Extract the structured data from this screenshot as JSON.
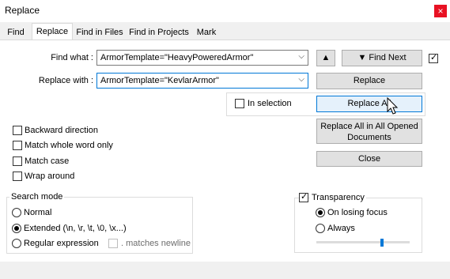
{
  "window": {
    "title": "Replace",
    "close_label": "×"
  },
  "tabs": [
    {
      "label": "Find"
    },
    {
      "label": "Replace"
    },
    {
      "label": "Find in Files"
    },
    {
      "label": "Find in Projects"
    },
    {
      "label": "Mark"
    }
  ],
  "find": {
    "label": "Find what :",
    "value": "ArmorTemplate=\"HeavyPoweredArmor\""
  },
  "replace": {
    "label": "Replace with :",
    "value": "ArmorTemplate=\"KevlarArmor\""
  },
  "buttons": {
    "up": "▲",
    "find_next": "▼ Find Next",
    "replace": "Replace",
    "replace_all": "Replace All",
    "replace_all_opened": "Replace All in All Opened Documents",
    "close": "Close"
  },
  "in_selection": {
    "label": "In selection",
    "checked": false
  },
  "options": [
    {
      "label": "Backward direction",
      "checked": false
    },
    {
      "label": "Match whole word only",
      "checked": false
    },
    {
      "label": "Match case",
      "checked": false
    },
    {
      "label": "Wrap around",
      "checked": false
    }
  ],
  "search_mode": {
    "title": "Search mode",
    "normal": "Normal",
    "extended": "Extended (\\n, \\r, \\t, \\0, \\x...)",
    "regex": "Regular expression",
    "matches_newline": ". matches newline",
    "selected": "extended"
  },
  "transparency": {
    "title": "Transparency",
    "checked": true,
    "on_losing_focus": "On losing focus",
    "always": "Always",
    "selected": "on_losing_focus",
    "level": 0.7
  },
  "dropdown_glyph": "⌵",
  "check_glyph": "✓"
}
